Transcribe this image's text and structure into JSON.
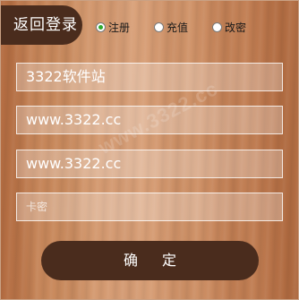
{
  "header": {
    "back_label": "返回登录"
  },
  "modes": [
    {
      "label": "注册",
      "selected": true
    },
    {
      "label": "充值",
      "selected": false
    },
    {
      "label": "改密",
      "selected": false
    }
  ],
  "fields": {
    "account_value": "3322软件站",
    "password_value": "www.3322.cc",
    "confirm_value": "www.3322.cc",
    "card_placeholder": "卡密"
  },
  "confirm_label": "确 定",
  "watermark": "www.3322.cc",
  "colors": {
    "button_bg": "#4a2c1d",
    "radio_checked": "#2eaa2e"
  }
}
